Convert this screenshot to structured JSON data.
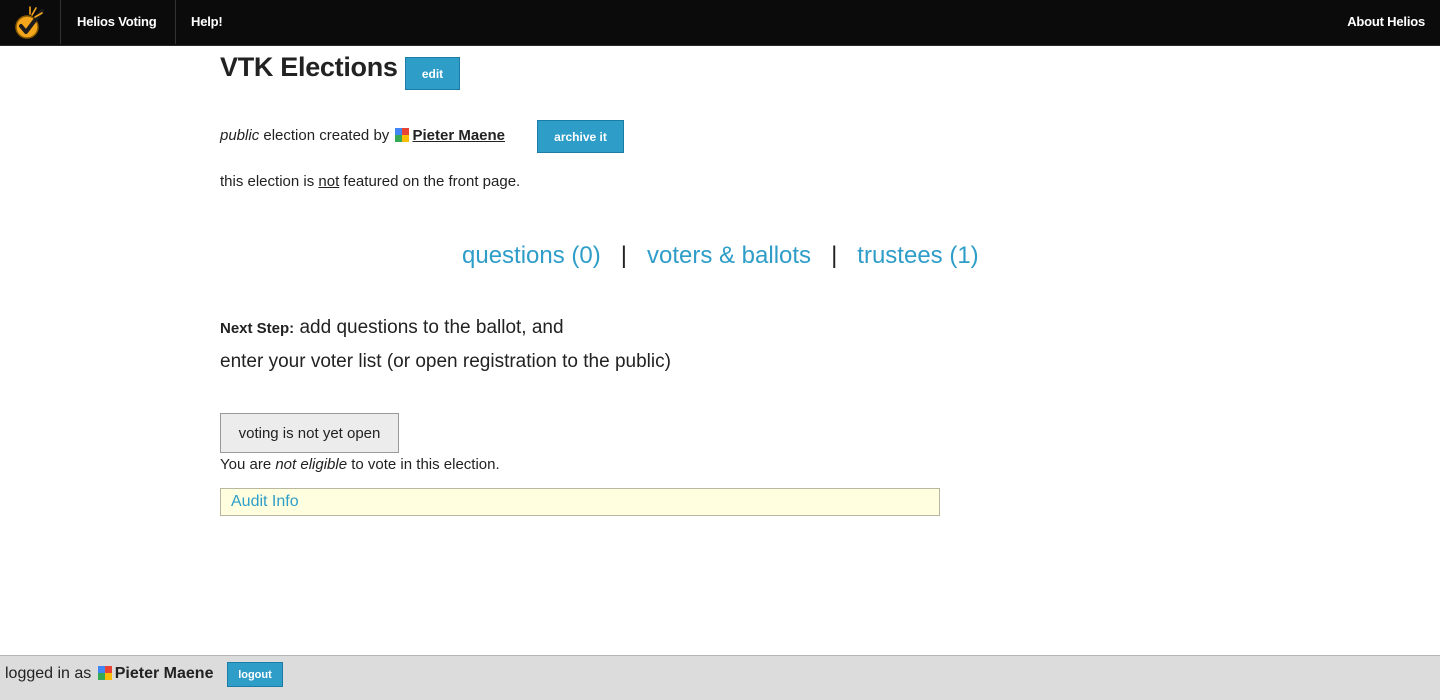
{
  "nav": {
    "brand": "Helios Voting",
    "help": "Help!",
    "about": "About Helios"
  },
  "election": {
    "title": "VTK Elections",
    "edit_label": "edit",
    "visibility": "public",
    "created_by_text": "election created by",
    "creator": "Pieter Maene",
    "archive_label": "archive it",
    "featured_prefix": "this election is",
    "featured_not": "not",
    "featured_suffix": "featured on the front page."
  },
  "tabs": {
    "questions": "questions (0)",
    "voters": "voters & ballots",
    "trustees": "trustees (1)",
    "separator": "|"
  },
  "next_step": {
    "label": "Next Step:",
    "line1": "add questions to the ballot, and",
    "line2": "enter your voter list (or open registration to the public)"
  },
  "voting": {
    "button_label": "voting is not yet open",
    "eligibility_prefix": "You are",
    "eligibility_emph": "not eligible",
    "eligibility_suffix": "to vote in this election."
  },
  "audit": {
    "label": "Audit Info"
  },
  "footer": {
    "logged_in_as": "logged in as",
    "user": "Pieter Maene",
    "logout_label": "logout"
  },
  "colors": {
    "accent": "#2e9dc8",
    "topbar": "#0b0b0b",
    "footer": "#dcdcdc",
    "audit_bg": "#ffffe0"
  }
}
